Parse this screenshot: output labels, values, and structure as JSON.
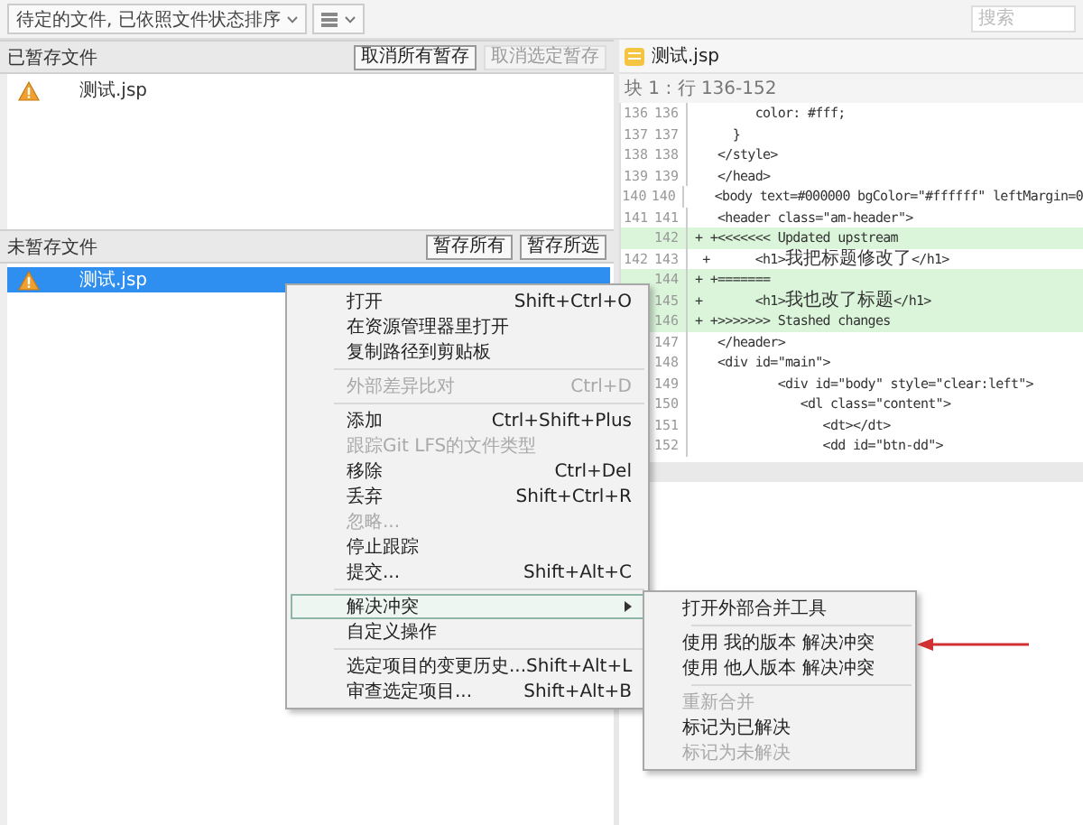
{
  "toolbar": {
    "filter": "待定的文件, 已依照文件状态排序",
    "search": {
      "placeholder": "搜索"
    }
  },
  "staged": {
    "title": "已暂存文件",
    "buttons": [
      {
        "label": "取消所有暂存",
        "disabled": false
      },
      {
        "label": "取消选定暂存",
        "disabled": true
      }
    ],
    "files": [
      {
        "name": "测试.jsp",
        "selected": false
      }
    ]
  },
  "unstaged": {
    "title": "未暂存文件",
    "buttons": [
      {
        "label": "暂存所有",
        "disabled": false
      },
      {
        "label": "暂存所选",
        "disabled": false
      }
    ],
    "files": [
      {
        "name": "测试.jsp",
        "selected": true
      }
    ]
  },
  "diff": {
    "file": "测试.jsp",
    "hunk": "块 1 : 行 136-152",
    "lines": [
      {
        "old": "136",
        "new": "136",
        "added": false,
        "code": "        color: #fff;"
      },
      {
        "old": "137",
        "new": "137",
        "added": false,
        "code": "     }"
      },
      {
        "old": "138",
        "new": "138",
        "added": false,
        "code": "   </style>"
      },
      {
        "old": "139",
        "new": "139",
        "added": false,
        "code": "   </head>"
      },
      {
        "old": "140",
        "new": "140",
        "added": false,
        "code": "   <body text=#000000 bgColor=\"#ffffff\" leftMargin=0"
      },
      {
        "old": "141",
        "new": "141",
        "added": false,
        "code": "   <header class=\"am-header\">"
      },
      {
        "new": "142",
        "added": true,
        "code": "+ +<<<<<<< Updated upstream"
      },
      {
        "old": "142",
        "new": "143",
        "added": false,
        "code": " +      <h1>我把标题修改了</h1>"
      },
      {
        "new": "144",
        "added": true,
        "code": "+ +======="
      },
      {
        "new": "145",
        "added": true,
        "code": "+       <h1>我也改了标题</h1>"
      },
      {
        "new": "146",
        "added": true,
        "code": "+ +>>>>>>> Stashed changes"
      },
      {
        "new": "147",
        "added": false,
        "code": "   </header>"
      },
      {
        "new": "148",
        "added": false,
        "code": "   <div id=\"main\">"
      },
      {
        "new": "149",
        "added": false,
        "code": "           <div id=\"body\" style=\"clear:left\">"
      },
      {
        "new": "150",
        "added": false,
        "code": "              <dl class=\"content\">"
      },
      {
        "new": "151",
        "added": false,
        "code": "                 <dt></dt>"
      },
      {
        "new": "152",
        "added": false,
        "code": "                 <dd id=\"btn-dd\">"
      }
    ]
  },
  "context_menu": {
    "items": [
      {
        "kind": "item",
        "label": "打开",
        "shortcut": "Shift+Ctrl+O",
        "disabled": false,
        "selected": false,
        "submenu": false
      },
      {
        "kind": "item",
        "label": "在资源管理器里打开",
        "disabled": false,
        "selected": false,
        "submenu": false
      },
      {
        "kind": "item",
        "label": "复制路径到剪贴板",
        "disabled": false,
        "selected": false,
        "submenu": false
      },
      {
        "kind": "separator"
      },
      {
        "kind": "item",
        "label": "外部差异比对",
        "shortcut": "Ctrl+D",
        "disabled": true,
        "selected": false,
        "submenu": false
      },
      {
        "kind": "separator"
      },
      {
        "kind": "item",
        "label": "添加",
        "shortcut": "Ctrl+Shift+Plus",
        "disabled": false,
        "selected": false,
        "submenu": false
      },
      {
        "kind": "item",
        "label": "跟踪Git LFS的文件类型",
        "disabled": true,
        "selected": false,
        "submenu": false
      },
      {
        "kind": "item",
        "label": "移除",
        "shortcut": "Ctrl+Del",
        "disabled": false,
        "selected": false,
        "submenu": false
      },
      {
        "kind": "item",
        "label": "丢弃",
        "shortcut": "Shift+Ctrl+R",
        "disabled": false,
        "selected": false,
        "submenu": false
      },
      {
        "kind": "item",
        "label": "忽略...",
        "disabled": true,
        "selected": false,
        "submenu": false
      },
      {
        "kind": "item",
        "label": "停止跟踪",
        "disabled": false,
        "selected": false,
        "submenu": false
      },
      {
        "kind": "item",
        "label": "提交...",
        "shortcut": "Shift+Alt+C",
        "disabled": false,
        "selected": false,
        "submenu": false
      },
      {
        "kind": "separator"
      },
      {
        "kind": "item",
        "label": "解决冲突",
        "disabled": false,
        "selected": true,
        "submenu": true
      },
      {
        "kind": "item",
        "label": "自定义操作",
        "disabled": false,
        "selected": false,
        "submenu": false
      },
      {
        "kind": "separator"
      },
      {
        "kind": "item",
        "label": "选定项目的变更历史...",
        "shortcut": "Shift+Alt+L",
        "disabled": false,
        "selected": false,
        "submenu": false
      },
      {
        "kind": "item",
        "label": "审查选定项目...",
        "shortcut": "Shift+Alt+B",
        "disabled": false,
        "selected": false,
        "submenu": false
      }
    ]
  },
  "submenu": {
    "items": [
      {
        "kind": "item",
        "label": "打开外部合并工具",
        "disabled": false,
        "selected": false
      },
      {
        "kind": "separator"
      },
      {
        "kind": "item",
        "label": "使用 我的版本 解决冲突",
        "disabled": false,
        "selected": false
      },
      {
        "kind": "item",
        "label": "使用 他人版本 解决冲突",
        "disabled": false,
        "selected": false
      },
      {
        "kind": "separator"
      },
      {
        "kind": "item",
        "label": "重新合并",
        "disabled": true,
        "selected": false
      },
      {
        "kind": "item",
        "label": "标记为已解决",
        "disabled": false,
        "selected": false
      },
      {
        "kind": "item",
        "label": "标记为未解决",
        "disabled": true,
        "selected": false
      }
    ]
  }
}
